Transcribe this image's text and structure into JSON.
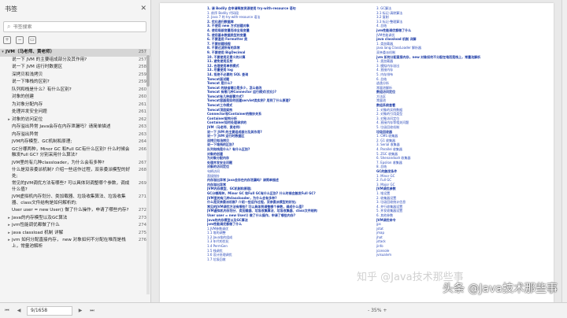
{
  "sidebar": {
    "title": "书签",
    "search_placeholder": "书签搜索",
    "items": [
      {
        "label": "JVM（马老师、黄老师）",
        "page": "257",
        "level": 0,
        "arrow": "▾",
        "active": true
      },
      {
        "label": "说一下 JVM 的主要组成部分及其作用?",
        "page": "257",
        "level": 1,
        "arrow": ""
      },
      {
        "label": "说一下 JVM 运行时数据区",
        "page": "258",
        "level": 1,
        "arrow": ""
      },
      {
        "label": "深拷贝和浅拷贝",
        "page": "259",
        "level": 1,
        "arrow": ""
      },
      {
        "label": "说一下堆栈的区别?",
        "page": "259",
        "level": 1,
        "arrow": ""
      },
      {
        "label": "队列和栈是什么？有什么区别?",
        "page": "260",
        "level": 1,
        "arrow": ""
      },
      {
        "label": "对象的创建",
        "page": "260",
        "level": 1,
        "arrow": ""
      },
      {
        "label": "为对象分配内存",
        "page": "261",
        "level": 1,
        "arrow": ""
      },
      {
        "label": "处理并发安全问题",
        "page": "261",
        "level": 1,
        "arrow": ""
      },
      {
        "label": "对象的访问定位",
        "page": "262",
        "level": 1,
        "arrow": "▸"
      },
      {
        "label": "内存溢出异常 Java会存在内存泄漏吗？请简单描述",
        "page": "263",
        "level": 1,
        "arrow": ""
      },
      {
        "label": "内存溢出异常",
        "page": "263",
        "level": 1,
        "arrow": ""
      },
      {
        "label": "JVM内存模型、GC机制和原理;",
        "page": "264",
        "level": 1,
        "arrow": ""
      },
      {
        "label": "GC分哪两种，Minor GC 和Full GC有什么区别? 什么时候会触发Full GC? 分别采用什么算法?",
        "page": "266",
        "level": 1,
        "arrow": ""
      },
      {
        "label": "JVM里的有几种classloader，为什么会有多种?",
        "page": "267",
        "level": 1,
        "arrow": ""
      },
      {
        "label": "什么是双亲委派机制? 介绍一些运作过程，双亲委派模型的好处;",
        "page": "268",
        "level": 1,
        "arrow": ""
      },
      {
        "label": "常见的JVM调优方法有哪些? 可以具体到调整哪个参数，调成什么值?",
        "page": "269",
        "level": 1,
        "arrow": ""
      },
      {
        "label": "JVM虚拟机内存划分、类加载器、垃圾收集算法、垃圾收集器、class文件结构是如何解析的;",
        "page": "271",
        "level": 1,
        "arrow": ""
      },
      {
        "label": "User user = new User() 做了什么操作，申请了哪些内存?",
        "page": "272",
        "level": 1,
        "arrow": ""
      },
      {
        "label": "Java的内存模型以及GC算法",
        "page": "273",
        "level": 1,
        "arrow": "▸"
      },
      {
        "label": "jvm性能调优都做了什么",
        "page": "274",
        "level": 1,
        "arrow": "▸"
      },
      {
        "label": "java classload 机制 详解",
        "page": "275",
        "level": 1,
        "arrow": "▸"
      },
      {
        "label": "jvm 如何分配直接内存， new 对象如何不分配在堆而是栈上，常量池解析",
        "page": "276",
        "level": 1,
        "arrow": "▸"
      }
    ]
  },
  "bottombar": {
    "page_indicator": "9/1658",
    "zoom": "- 35% +"
  },
  "document": {
    "col_a": [
      "1. 请 Bodily 会申请释放资源使用 try-with-resource 语句",
      "  1. 前序 Bodily 代码段",
      "  2. Java 7 的 try-with-resource 语法",
      "2. 优化递归数据库",
      "3. 不使用 new 方式创建对象",
      "4. 使用局部变量而非全局变量",
      "5. 使用基本数据类型的变量",
      "6. 不要滥用 Formatter 类",
      "7. 不要创建线程",
      "8. 不要过滤所有的异常",
      "9. 不要使用 BigDecimal",
      "10. 不要使用无意义的计算",
      "11. 避免使用反射",
      "12. 合理使用单例模式",
      "13. 尽量使用 log",
      "14. 拒绝不必要的 SQL 查询",
      "Tomcat面试题",
      "Tomcat 是什么?",
      "Tomcat 的缺省端口是多少，怎么修改",
      "Tomcat 有哪几种Connector 运行模式(优化)?",
      "Tomcat有几种部署方式?",
      "Tomcat容器是如何创建servlet类实例? 用到了什么原理?",
      "Tomcat工作模式",
      "Tomcat顶层架构",
      "Connector和Container的微妙关系",
      "Container架构分析",
      "Container如何处理请求的",
      "JVM（马老师、黄老师）",
      "说一下 JVM 的主要组成部分及其作用?",
      "说一下 JVM 运行时数据区",
      "深拷贝和浅拷贝",
      "说一下堆栈的区别?",
      "队列和栈是什么？有什么区别?",
      "对象的创建",
      "为对象分配内存",
      "处理并发安全问题",
      "对象的访问定位",
      "  句柄访问",
      "  直接指针",
      "内存溢出异常 Java会存在内存泄漏吗？请简单描述",
      "内存溢出异常",
      "JVM内存模型、GC机制和原理;",
      "GC分哪两种，Minor GC 和Full GC有什么区别? 什么时候会触发Full GC?",
      "JVM里的有几种classloader，为什么会有多种?",
      "什么是双亲委派机制? 介绍一些运作过程，双亲委派模型的好处;",
      "常见的JVM调优方法有哪些? 可以具体到调整哪个参数，调成什么值?",
      "JVM虚拟机内存划分、类加载器、垃圾收集算法、垃圾收集器、class文件结构",
      "User user = new User() 做了什么操作，申请了哪些内存?",
      "Java的内存模型以及GC算法",
      "jvm性能调优都做了什么",
      "  1.JVM参数调优",
      "    1.1 堆的调整",
      "    1.2 Java堆的组成",
      "    1.3 年代的优化",
      "    1.4 PermGen",
      "    1.5 栈调优",
      "    1.6 设计处理调优",
      "    1.7 垃圾回收"
    ],
    "col_b": [
      "    3. GC算法",
      "      3.1 标记-清除算法",
      "      3.2 复制",
      "      3.3 标记-整理算法",
      "  4. 总结",
      "jvm性能调优都做了什么",
      "  JVM性能调优",
      "java classload 机制 详解",
      "  1. 类加载器",
      "    java.lang.ClassLoader 解析器",
      "    双亲委派机制",
      "jvm 如何分配直接内存，new 对象如何不分配在堆而是栈上，常量池解析",
      "  1. 类加载器",
      "  3. 模拟内存溢出",
      "  4. 直接内存",
      "  5. 内存排布",
      "  6. 总结",
      "  逃逸分析",
      "  常量池解析",
      "数组访问定位",
      "  方法区",
      "  常量池",
      "数组系统查看",
      "  1. 对象的实例数据",
      "  2. 对象的引用类型",
      "  3. 对象访问定位",
      "  4. 直接内存等相关问题",
      "  5. 垃圾回收机制",
      "垃圾回收器",
      "  1. CMS 收集器",
      "  2. G1 收集器",
      "  3. Serial 收集器",
      "  4. Parallel 收集器",
      "  5. ZGC 收集器",
      "  6. Shenandoah 收集器",
      "  7. Epsilon 收集器",
      "  8. 总结",
      "GC的触发条件",
      "  1. Minor GC",
      "  2. Full GC",
      "  3. Major GC",
      "JVM调优参数",
      "  1. 堆设置",
      "  2. 收集器设置",
      "  3. 垃圾回收统计信息",
      "  4. 并行收集器设置",
      "  5. 并发收集器设置",
      "  6. 其他参数",
      "JVM调优命令",
      "  jps",
      "  jstat",
      "  jmap",
      "  jhat",
      "  jstack",
      "  jinfo",
      "  jconsole",
      "  jvisualvm"
    ],
    "watermark_main": "头条 @Java技术那些事",
    "watermark_faint": "知乎 @Java技术那些事"
  }
}
